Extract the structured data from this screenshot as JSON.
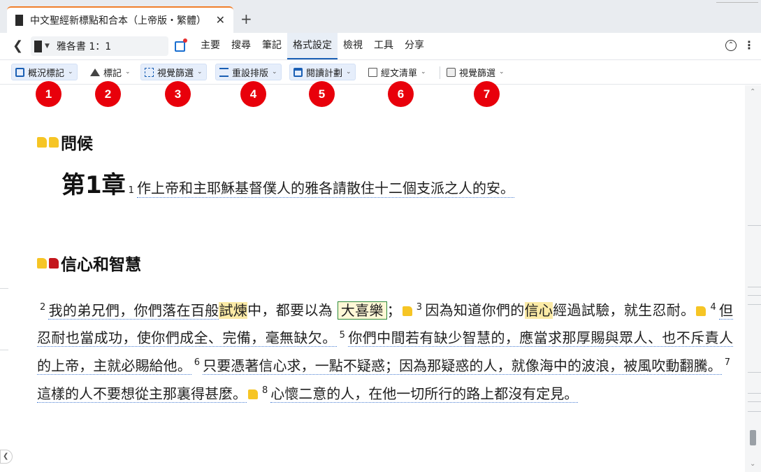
{
  "tab": {
    "title": "中文聖經新標點和合本（上帝版・繁體）",
    "close_glyph": "✕",
    "new_tab_glyph": "+"
  },
  "nav": {
    "reference": "雅各書 1：1",
    "menu": [
      {
        "label": "主要",
        "active": false
      },
      {
        "label": "搜尋",
        "active": false
      },
      {
        "label": "筆記",
        "active": false
      },
      {
        "label": "格式設定",
        "active": true
      },
      {
        "label": "檢視",
        "active": false
      },
      {
        "label": "工具",
        "active": false
      },
      {
        "label": "分享",
        "active": false
      }
    ]
  },
  "toolbar": {
    "overview_markup": "概況標記",
    "markup": "標記",
    "visual_filter": "視覺篩選",
    "paragraph_layout": "重設排版",
    "reading_plan": "閱讀計劃",
    "passage_list": "經文清單",
    "visual_filter_2": "視覺篩選"
  },
  "badges": [
    "1",
    "2",
    "3",
    "4",
    "5",
    "6",
    "7"
  ],
  "badge_color": "#e8000b",
  "content": {
    "heading1": "問候",
    "chapter_label": "第1章",
    "v1_num": "1",
    "v1_text": "作上帝和主耶穌基督僕人的雅各請散住十二個支派之人的安。",
    "heading2": "信心和智慧",
    "v2_num": "2",
    "v2_a": "我的弟兄們，你們落在百般",
    "v2_hl": "試煉",
    "v2_b": "中，都要以為",
    "v2_box": "大喜樂",
    "v2_c": "；",
    "v3_num": "3",
    "v3_a": "因為知道你們的",
    "v3_hl": "信心",
    "v3_b": "經過試驗，就生忍耐。",
    "v4_num": "4",
    "v4": "但忍耐也當成功，使你們成全、完備，毫無缺欠。",
    "v5_num": "5",
    "v5": "你們中間若有缺少智慧的，應當求那厚賜與眾人、也不斥責人的上帝，主就必賜給他。",
    "v6_num": "6",
    "v6": "只要憑著信心求，一點不疑惑；因為那疑惑的人，就像海中的波浪，被風吹動翻騰。",
    "v7_num": "7",
    "v7": "這樣的人不要想從主那裏得甚麼。",
    "v8_num": "8",
    "v8": "心懷二意的人，在他一切所行的路上都沒有定見。"
  },
  "colors": {
    "accent": "#1a5fb4",
    "tab_border": "#f07f2a",
    "highlight": "#fbeaa6",
    "box_border": "#2e8b3a"
  }
}
